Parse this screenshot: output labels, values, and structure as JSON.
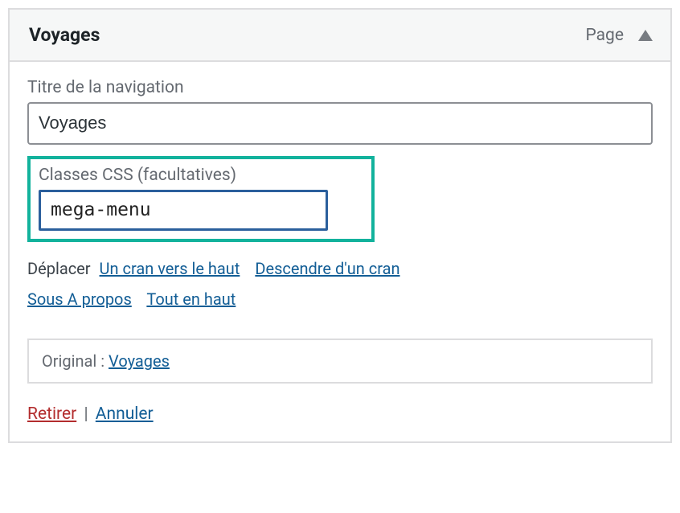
{
  "header": {
    "title": "Voyages",
    "type": "Page"
  },
  "fields": {
    "nav_title_label": "Titre de la navigation",
    "nav_title_value": "Voyages",
    "css_classes_label": "Classes CSS (facultatives)",
    "css_classes_value": "mega-menu"
  },
  "move": {
    "label": "Déplacer",
    "up_one": "Un cran vers le haut",
    "down_one": "Descendre d'un cran",
    "under_parent": "Sous A propos",
    "to_top": "Tout en haut"
  },
  "original": {
    "label": "Original : ",
    "link": "Voyages"
  },
  "actions": {
    "remove": "Retirer",
    "cancel": "Annuler",
    "separator": " | "
  }
}
